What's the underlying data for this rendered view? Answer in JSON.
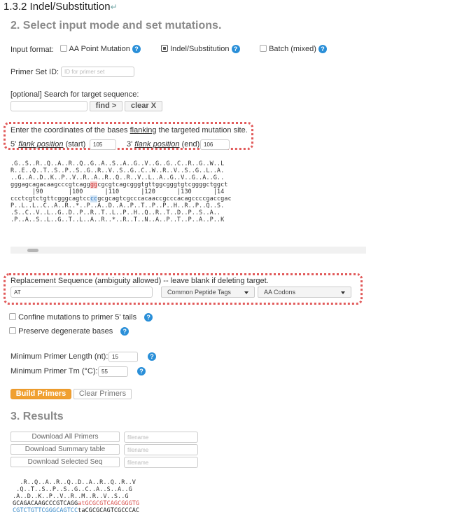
{
  "section_heading": "1.3.2 Indel/Substitution",
  "heading_return_mark": "↵",
  "step2": {
    "title": "2. Select input mode and set mutations.",
    "input_format_label": "Input format:",
    "modes": [
      {
        "label": "AA Point Mutation",
        "checked": false
      },
      {
        "label": "Indel/Substitution",
        "checked": true
      },
      {
        "label": "Batch (mixed)",
        "checked": false
      }
    ],
    "primer_set_label": "Primer Set ID:",
    "primer_set_placeholder": "ID for primer set",
    "search_label": "[optional] Search for target sequence:",
    "search_value": "",
    "find_button": "find >",
    "clear_button": "clear X",
    "flank_instruction_pre": "Enter the coordinates of the bases ",
    "flank_instruction_link": "flanking",
    "flank_instruction_post": " the targeted mutation site.",
    "flank_5_prime": "5'",
    "flank_5_link": "flank position",
    "flank_5_suffix": "(start)",
    "flank_5_value": "105",
    "flank_3_prime": "3'",
    "flank_3_link": "flank position",
    "flank_3_suffix": "(end)",
    "flank_3_value": "106"
  },
  "sequence_view": {
    "row1": ".G..S..R..Q..A..R..Q..G..A..S..A..G..V..G..G..C..R..G..W..L",
    "row2": "R..E..Q..T..S..P..S..G..R..V..S..G..C..W..R..V..S..G..L..A.",
    "row3": "..G..A..D..K..P..V..R..A..R..Q..R..V..L..A..G..V..G..A..G..",
    "top_pre": "gggagcagacaagcccgtcagg",
    "top_hl": "gg",
    "top_post": "cgcgtcagcgggtgttggcgggtgtcggggctggct",
    "ruler": "      |90       |100      |110      |120      |130      |14",
    "bot_pre": "ccctcgtctgttcgggcagtcc",
    "bot_hl": "cc",
    "bot_post": "gcgcagtcgcccacaaccgcccacagccccgaccgac",
    "row4": "P..L..L..C..A..R..*..P..A..D..A..P..T..P..P..H..R..P..Q..S.",
    "row5": ".S..C..V..L..G..D..P..R..T..L..P..H..Q..R..T..D..P..S..A..",
    "row6": ".P..A..S..L..G..T..L..A..R..*..R..T..N..A..P..T..P..A..P..K"
  },
  "replacement": {
    "label": "Replacement Sequence (ambiguity allowed) -- leave blank if deleting target.",
    "value": "AT",
    "tags_select": "Common Peptide Tags",
    "codons_select": "AA Codons"
  },
  "options": {
    "confine_label": "Confine mutations to primer 5' tails",
    "preserve_label": "Preserve degenerate bases",
    "min_length_label": "Minimum Primer Length (nt):",
    "min_length_value": "15",
    "min_tm_label": "Minimum Primer Tm (°C):",
    "min_tm_value": "55",
    "build_button": "Build Primers",
    "clear_primers_button": "Clear Primers"
  },
  "results": {
    "title": "3. Results",
    "download_all": "Download All Primers",
    "download_summary": "Download Summary table",
    "download_selected": "Download Selected Seq",
    "filename_placeholder": "filename",
    "r1": "  .R..Q..A..R..Q..D..A..R..Q..R..V",
    "r2": " .Q..T..S..P..S..G..C..A..S..A..G",
    "r3": ".A..D..K..P..V..R..M..R..V..S..G",
    "top_black": "GCAGACAAGCCCGTCAGG",
    "top_red": "atGCGCGTCAGCGGGTG",
    "bot_blue": "CGTCTGTTCGGGCAGTCC",
    "bot_black": "taCGCGCAGTCGCCCAC"
  },
  "colors": {
    "accent_orange": "#f0a030",
    "help_blue": "#2a8fd8",
    "dotted_red": "#e15a5a",
    "heading_gray": "#8a8a8a"
  }
}
